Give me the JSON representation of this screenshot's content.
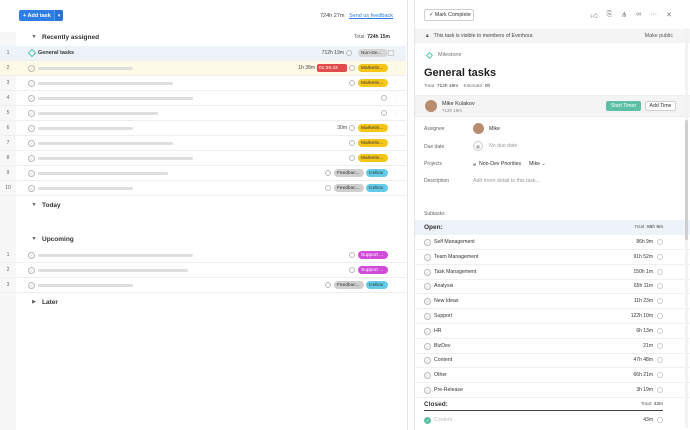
{
  "toolbar": {
    "add_task_label": "+ Add task",
    "dropdown_glyph": "▾",
    "total_time": "724h 27m",
    "feedback_link": "Send us feedback"
  },
  "sections": {
    "recently_assigned": {
      "label": "Recently assigned",
      "total_label": "Total:",
      "total_value": "724h 15m"
    },
    "today": {
      "label": "Today"
    },
    "upcoming": {
      "label": "Upcoming"
    },
    "later": {
      "label": "Later"
    }
  },
  "recent_rows": [
    {
      "num": "1",
      "title": "General tasks",
      "time": "712h 19m",
      "tags": [
        "Non-De..."
      ]
    },
    {
      "num": "2",
      "time": "1h 38m",
      "timer": "01:36:43",
      "tags": [
        "Marketin..."
      ]
    },
    {
      "num": "3",
      "tags": [
        "Marketin..."
      ]
    },
    {
      "num": "4"
    },
    {
      "num": "5"
    },
    {
      "num": "6",
      "time": "30m",
      "tags": [
        "Marketin..."
      ]
    },
    {
      "num": "7",
      "tags": [
        "Marketin..."
      ]
    },
    {
      "num": "8",
      "tags": [
        "Marketin..."
      ]
    },
    {
      "num": "9",
      "tags": [
        "Feedbac...",
        "Icebox"
      ]
    },
    {
      "num": "10",
      "tags": [
        "Feedbac...",
        "Icebox"
      ]
    }
  ],
  "upcoming_rows": [
    {
      "num": "1",
      "tags": [
        "Support ..."
      ]
    },
    {
      "num": "2",
      "tags": [
        "Support ..."
      ]
    },
    {
      "num": "3",
      "tags": [
        "Feedbac...",
        "Icebox"
      ]
    }
  ],
  "detail": {
    "mark_complete": "✓ Mark Complete",
    "visibility_text": "This task is visible to members of Everhour.",
    "make_public": "Make public",
    "milestone": "Milestone",
    "title": "General tasks",
    "total_label": "Total:",
    "total_value": "712h 19m",
    "estimate_label": "Estimate:",
    "estimate_value": "0h",
    "person_name": "Mike Kulakov",
    "person_time": "712h 19m",
    "start_timer": "Start Timer",
    "add_time": "Add Time",
    "assignee_label": "Assignee",
    "assignee_value": "Mike",
    "due_label": "Due date",
    "due_value": "No due date",
    "projects_label": "Projects",
    "project_value": "Non-Dev Priorities",
    "project_owner": "Mike ⌄",
    "description_label": "Description",
    "description_placeholder": "Add more detail to this task...",
    "subtasks_label": "Subtasks",
    "open_label": "Open:",
    "open_total_label": "Total:",
    "open_total_value": "86h 9m",
    "subtasks": [
      {
        "name": "Self Management",
        "time": "86h 9m"
      },
      {
        "name": "Team Management",
        "time": "91h 52m"
      },
      {
        "name": "Task Management",
        "time": "150h 1m"
      },
      {
        "name": "Analysis",
        "time": "65h 11m"
      },
      {
        "name": "New Ideas",
        "time": "11h 23m"
      },
      {
        "name": "Support",
        "time": "122h 10m"
      },
      {
        "name": "HR",
        "time": "6h 13m"
      },
      {
        "name": "BizDev",
        "time": "21m"
      },
      {
        "name": "Content",
        "time": "47h 48m"
      },
      {
        "name": "Other",
        "time": "66h 21m"
      },
      {
        "name": "Pre-Release",
        "time": "3h 19m"
      }
    ],
    "closed_label": "Closed:",
    "closed_total_label": "Total:",
    "closed_total_value": "43m",
    "closed_item": {
      "name": "Content",
      "time": "43m"
    }
  },
  "colors": {
    "accent": "#2d7ee6",
    "marketing": "#f5c518",
    "timer": "#e24b4b",
    "support": "#d04bd8",
    "icebox": "#63cbe8",
    "start_timer": "#5bc0a5"
  }
}
